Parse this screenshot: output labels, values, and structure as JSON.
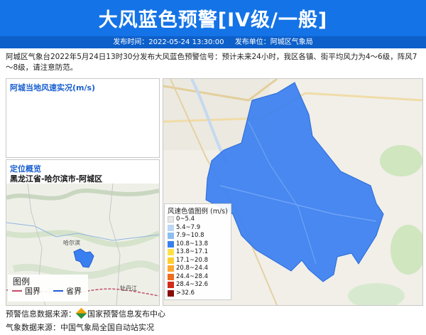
{
  "header": {
    "title": "大风蓝色预警[IV级/一般]",
    "publish_time_label": "发布时间：2022-05-24 13:30:00",
    "publish_unit_label": "发布单位：阿城区气象局",
    "bg_color": "#1473e6"
  },
  "description": "阿城区气象台2022年5月24日13时30分发布大风蓝色预警信号：预计未来24小时，我区各镇、街平均风力为4～6级，阵风7～8级，请注意防范。",
  "wind_panel": {
    "title": "阿城当地风速实况(m/s)"
  },
  "location_panel": {
    "title": "定位概览",
    "path": "黑龙江省-哈尔滨市-阿城区",
    "map_labels": {
      "harbin": "哈尔滨",
      "mudanjiang": "牡丹江"
    },
    "legend": {
      "title": "图例",
      "items": [
        {
          "label": "国界",
          "color": "#c0506a"
        },
        {
          "label": "省界",
          "color": "#1c5bd8"
        }
      ]
    }
  },
  "map": {
    "legend_title": "风速色值图例 (m/s)",
    "legend_items": [
      {
        "label": "0~5.4",
        "color": "#e8e8e8"
      },
      {
        "label": "5.4~7.9",
        "color": "#bcd7f5"
      },
      {
        "label": "7.9~10.8",
        "color": "#8fbdf0"
      },
      {
        "label": "10.8~13.8",
        "color": "#3a7ff0"
      },
      {
        "label": "13.8~17.1",
        "color": "#ffe14a"
      },
      {
        "label": "17.1~20.8",
        "color": "#ffd032"
      },
      {
        "label": "20.8~24.4",
        "color": "#ffa833"
      },
      {
        "label": "24.4~28.4",
        "color": "#f06c1e"
      },
      {
        "label": "28.4~32.6",
        "color": "#d42a1a"
      },
      {
        "label": ">32.6",
        "color": "#8a0c08"
      }
    ],
    "region_color": "#3a7ff0"
  },
  "footer": {
    "source1_label": "预警信息数据来源：",
    "source1_value": "国家预警信息发布中心",
    "source2": "气象数据来源：中国气象局全国自动站实况"
  }
}
